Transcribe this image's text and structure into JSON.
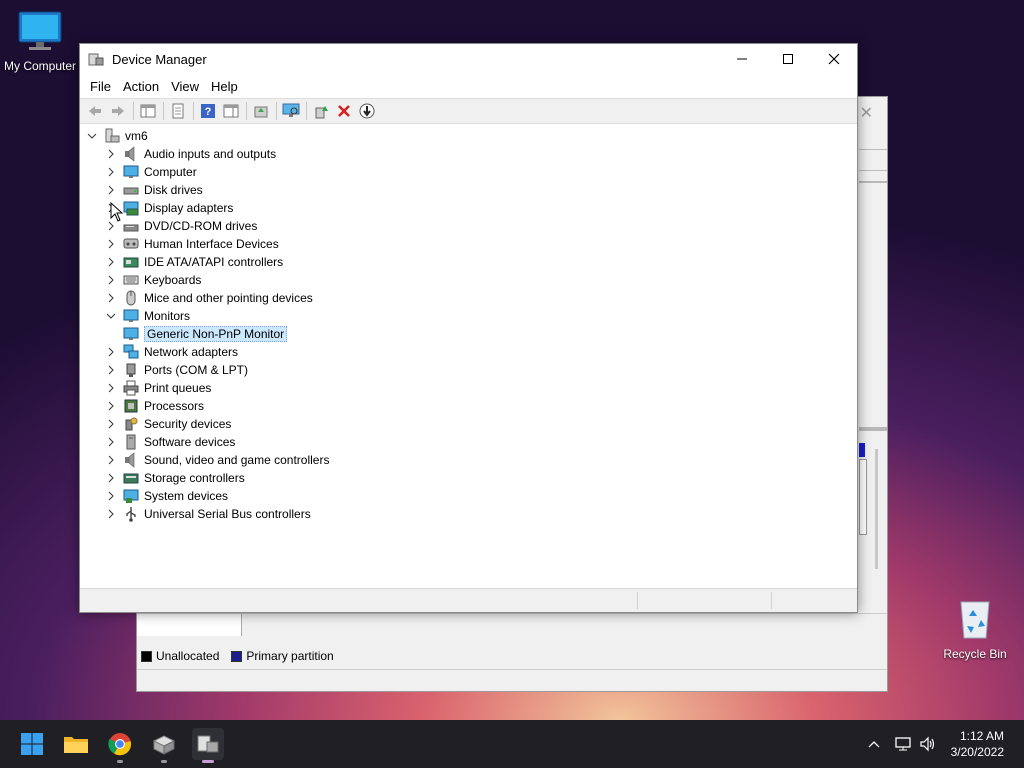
{
  "desktop": {
    "my_computer_label": "My Computer",
    "recycle_bin_label": "Recycle Bin"
  },
  "disk_management_window": {
    "legend": [
      {
        "label": "Unallocated",
        "color": "#000000"
      },
      {
        "label": "Primary partition",
        "color": "#1c1c8c"
      }
    ]
  },
  "device_manager": {
    "title": "Device Manager",
    "menu": [
      "File",
      "Action",
      "View",
      "Help"
    ],
    "toolbar_icons": [
      "back-arrow-icon",
      "forward-arrow-icon",
      "show-hide-console-tree-icon",
      "properties-icon",
      "help-icon",
      "action-pane-icon",
      "update-driver-icon",
      "scan-hardware-icon",
      "enable-device-icon",
      "uninstall-device-icon",
      "disable-device-icon"
    ],
    "tree": {
      "root": "vm6",
      "categories": [
        {
          "label": "Audio inputs and outputs",
          "icon": "speaker-icon",
          "expanded": false
        },
        {
          "label": "Computer",
          "icon": "monitor-icon",
          "expanded": false
        },
        {
          "label": "Disk drives",
          "icon": "disk-drive-icon",
          "expanded": false
        },
        {
          "label": "Display adapters",
          "icon": "display-adapter-icon",
          "expanded": false
        },
        {
          "label": "DVD/CD-ROM drives",
          "icon": "dvd-drive-icon",
          "expanded": false
        },
        {
          "label": "Human Interface Devices",
          "icon": "hid-icon",
          "expanded": false
        },
        {
          "label": "IDE ATA/ATAPI controllers",
          "icon": "ide-controller-icon",
          "expanded": false
        },
        {
          "label": "Keyboards",
          "icon": "keyboard-icon",
          "expanded": false
        },
        {
          "label": "Mice and other pointing devices",
          "icon": "mouse-icon",
          "expanded": false
        },
        {
          "label": "Monitors",
          "icon": "monitor-icon",
          "expanded": true,
          "children": [
            "Generic Non-PnP Monitor"
          ]
        },
        {
          "label": "Network adapters",
          "icon": "network-adapter-icon",
          "expanded": false
        },
        {
          "label": "Ports (COM & LPT)",
          "icon": "port-icon",
          "expanded": false
        },
        {
          "label": "Print queues",
          "icon": "printer-icon",
          "expanded": false
        },
        {
          "label": "Processors",
          "icon": "processor-icon",
          "expanded": false
        },
        {
          "label": "Security devices",
          "icon": "security-key-icon",
          "expanded": false
        },
        {
          "label": "Software devices",
          "icon": "software-device-icon",
          "expanded": false
        },
        {
          "label": "Sound, video and game controllers",
          "icon": "speaker-icon",
          "expanded": false
        },
        {
          "label": "Storage controllers",
          "icon": "storage-controller-icon",
          "expanded": false
        },
        {
          "label": "System devices",
          "icon": "system-devices-icon",
          "expanded": false
        },
        {
          "label": "Universal Serial Bus controllers",
          "icon": "usb-icon",
          "expanded": false
        }
      ],
      "selected": "Generic Non-PnP Monitor"
    }
  },
  "taskbar": {
    "apps": [
      "start-icon",
      "file-explorer-icon",
      "chrome-icon",
      "computer-management-icon",
      "device-manager-icon"
    ],
    "active_app": "device-manager-icon",
    "clock_time": "1:12 AM",
    "clock_date": "3/20/2022"
  }
}
